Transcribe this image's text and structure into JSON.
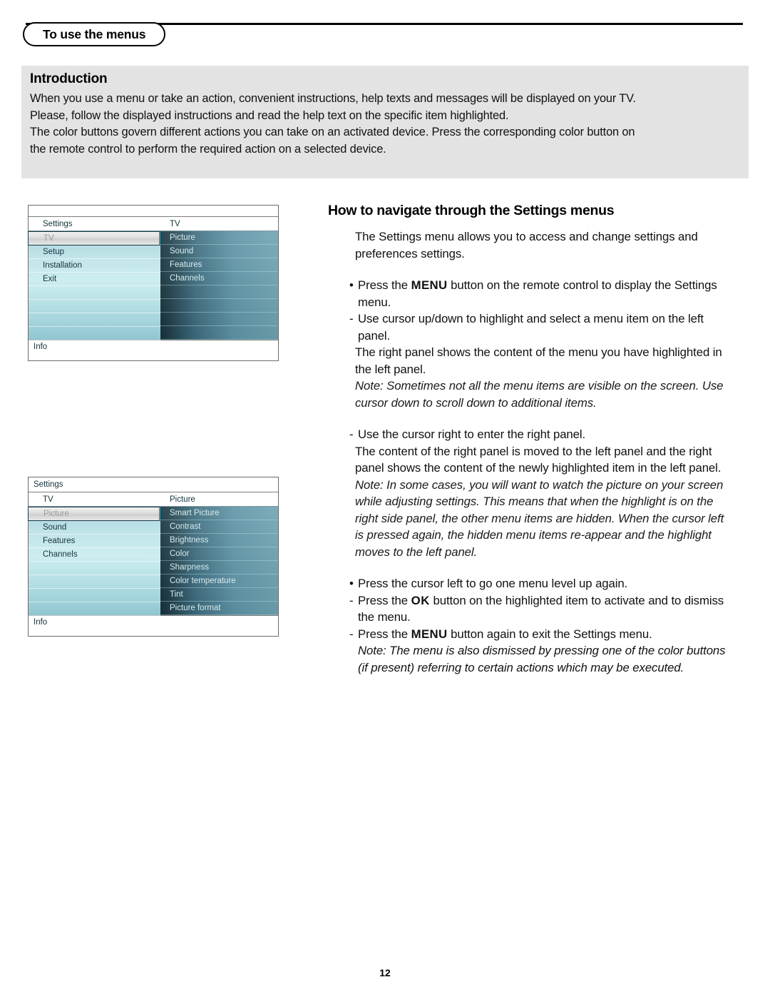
{
  "header": {
    "chapter_tab": "To use the menus"
  },
  "intro": {
    "title": "Introduction",
    "lines": [
      "When you use a menu or take an action, convenient instructions, help texts and messages will be displayed on your TV.",
      "Please, follow the displayed instructions and read the help text on the specific item highlighted.",
      "The color buttons govern different actions you can take on an activated device. Press the corresponding color button on",
      "the remote control to perform the required action on a selected device."
    ]
  },
  "tv_menu_1": {
    "topbar_label": "",
    "left_header": "Settings",
    "right_header": "TV",
    "left_items": [
      "TV",
      "Setup",
      "Installation",
      "Exit"
    ],
    "left_selected_index": 0,
    "right_items": [
      "Picture",
      "Sound",
      "Features",
      "Channels"
    ],
    "footer": "Info"
  },
  "tv_menu_2": {
    "topbar_label": "Settings",
    "left_header": "TV",
    "right_header": "Picture",
    "left_items": [
      "Picture",
      "Sound",
      "Features",
      "Channels"
    ],
    "left_selected_index": 0,
    "right_items": [
      "Smart Picture",
      "Contrast",
      "Brightness",
      "Color",
      "Sharpness",
      "Color temperature",
      "Tint",
      "Picture format"
    ],
    "footer": "Info"
  },
  "navigate_section": {
    "title": "How to navigate through the Settings menus",
    "intro_para": "The Settings menu allows you to access and change settings and preferences settings.",
    "items": [
      {
        "mark": "•",
        "pre": "Press the ",
        "kbd": "MENU",
        "post": " button on the remote control to display the Settings menu.",
        "style": "normal"
      },
      {
        "mark": "-",
        "pre": "",
        "kbd": "",
        "post": "Use cursor up/down to highlight and select a menu item on the left panel.",
        "style": "normal"
      }
    ],
    "para_right_panel": "The right panel shows the content of the  menu you have highlighted in the left panel.",
    "note_1": "Note: Sometimes not all the menu items are visible on the screen. Use cursor down to scroll down to additional items.",
    "item_cursor_right": {
      "mark": "-",
      "text": "Use the cursor right to enter the right panel."
    },
    "para_content_moved": "The content of the right panel is moved to the left panel and the right panel shows the content of the newly highlighted item in the left panel.",
    "note_2": "Note: In some cases, you will want to watch the picture on your screen while adjusting settings. This means that when the highlight is on the right side panel, the other menu items are hidden. When the cursor left is pressed again, the hidden menu items re-appear and the highlight moves to the left panel.",
    "item_cursor_left": {
      "mark": "•",
      "text": "Press the cursor left to go one menu level up again."
    },
    "item_ok": {
      "mark": "-",
      "pre": "Press the ",
      "kbd": "OK",
      "post": " button on the highlighted item to activate and to dismiss the menu."
    },
    "item_menu_exit": {
      "mark": "-",
      "pre": "Press the ",
      "kbd": "MENU",
      "post": " button again to exit the Settings menu."
    },
    "note_3": "Note: The menu is also dismissed by pressing one of the color buttons (if present) referring to certain actions which may be executed."
  },
  "footer": {
    "page_number": "12"
  }
}
